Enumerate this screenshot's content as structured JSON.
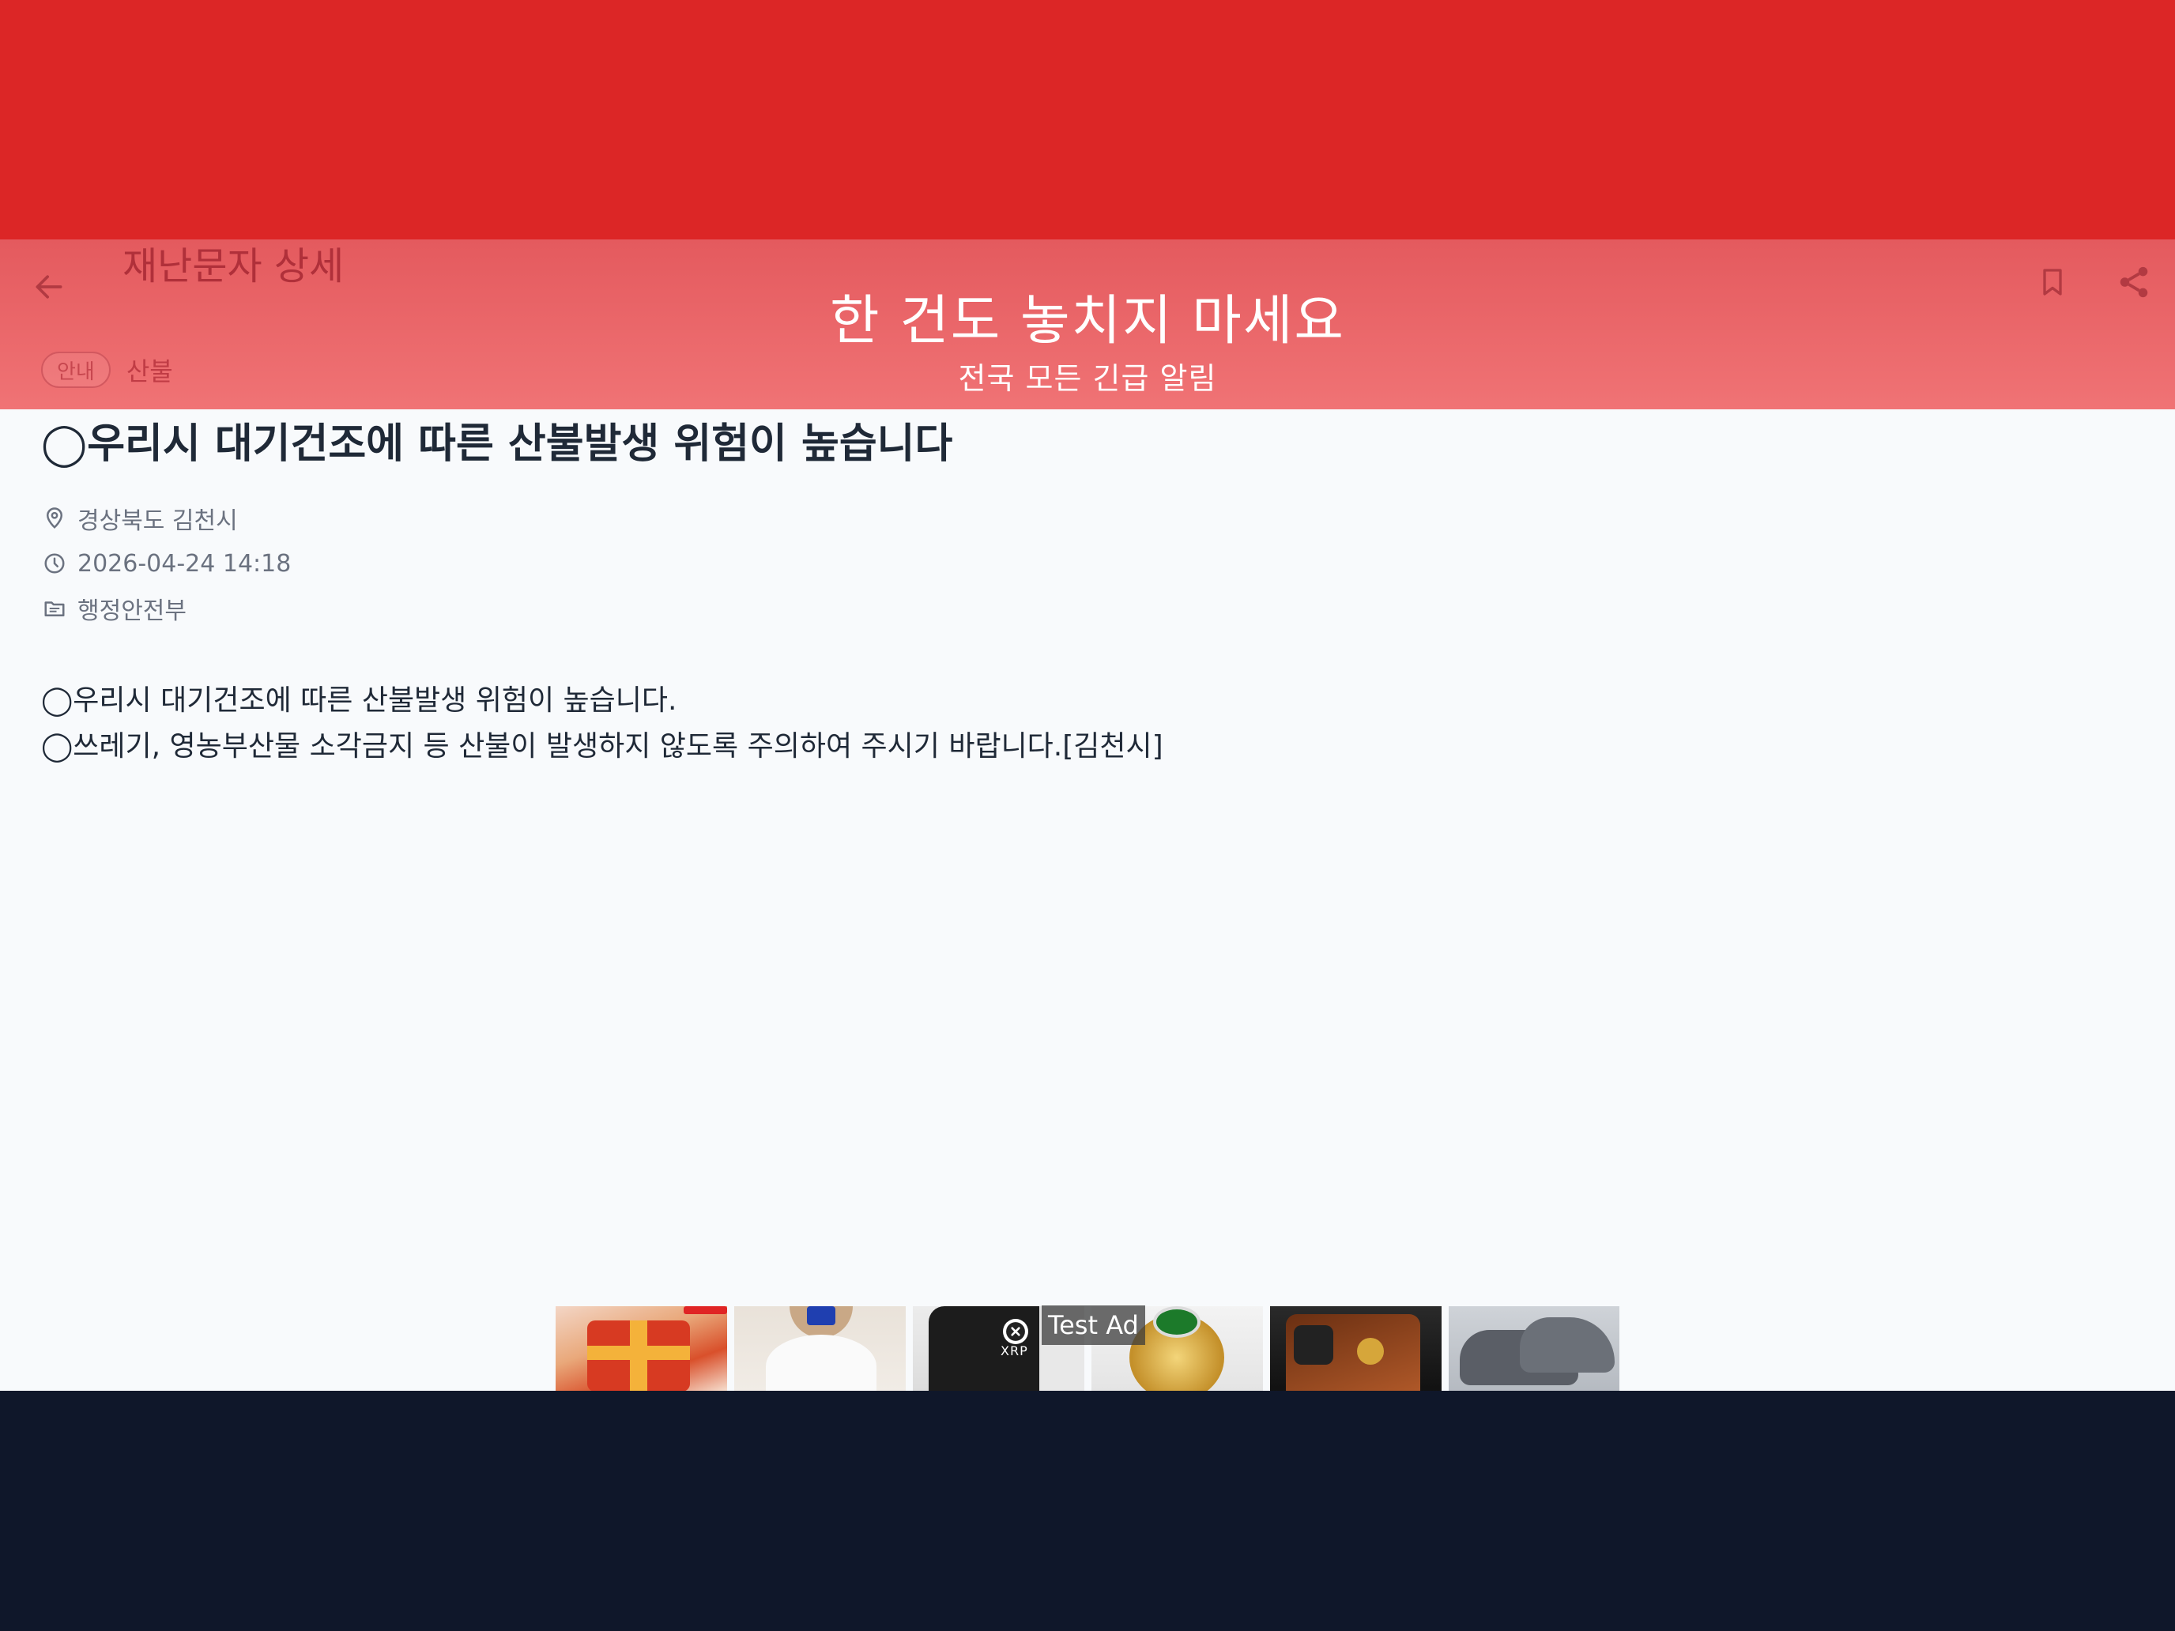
{
  "banner": {
    "title": "한 건도 놓치지 마세요",
    "subtitle": "전국 모든 긴급 알림"
  },
  "appbar": {
    "title": "재난문자 상세",
    "back_icon": "arrow-left-icon",
    "bookmark_icon": "bookmark-icon",
    "share_icon": "share-icon"
  },
  "tags": {
    "badge": "안내",
    "category": "산불"
  },
  "message": {
    "title": "◯우리시 대기건조에 따른 산불발생 위험이 높습니다",
    "region": "경상북도 김천시",
    "datetime": "2026-04-24 14:18",
    "agency": "행정안전부",
    "body_lines": [
      "◯우리시 대기건조에 따른 산불발생 위험이 높습니다.",
      "◯쓰레기, 영농부산물 소각금지 등 산불이 발생하지 않도록 주의하여 주시기 바랍니다.[김천시]"
    ]
  },
  "ad": {
    "label": "Test Ad",
    "brand": "XRP",
    "close_icon": "close-circle-icon"
  },
  "colors": {
    "banner_red": "#dc2626",
    "banner_overlay": "#f07375",
    "background": "#f8fafc",
    "bottom": "#0f172a",
    "text_primary": "#1f2937",
    "text_secondary": "#6b7280"
  }
}
